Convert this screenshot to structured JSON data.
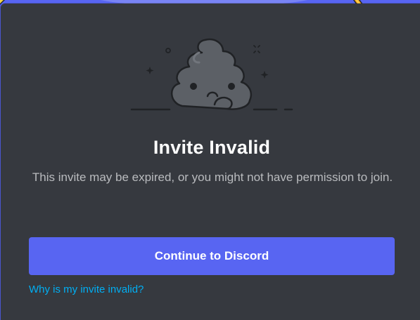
{
  "modal": {
    "illustration_icon": "sad-poop-icon",
    "title": "Invite Invalid",
    "description": "This invite may be expired, or you might not have permission to join.",
    "continue_label": "Continue to Discord",
    "help_link": "Why is my invite invalid?"
  },
  "colors": {
    "background": "#5865f2",
    "modal": "#36393f",
    "button": "#5865f2",
    "link": "#00aff4",
    "title": "#ffffff",
    "body_text": "#b9bbbe"
  }
}
